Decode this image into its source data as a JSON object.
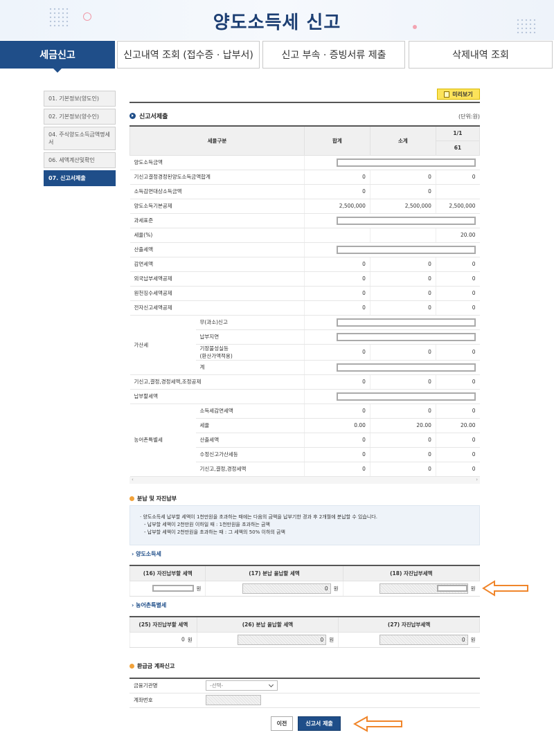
{
  "header": {
    "title": "양도소득세 신고"
  },
  "tabs": [
    {
      "label": "세금신고"
    },
    {
      "label": "신고내역 조회 (접수증 · 납부서)"
    },
    {
      "label": "신고 부속 · 증빙서류 제출"
    },
    {
      "label": "삭제내역 조회"
    }
  ],
  "sidebar": {
    "items": [
      {
        "label": "01. 기본정보(양도인)"
      },
      {
        "label": "02. 기본정보(양수인)"
      },
      {
        "label": "04. 주식양도소득금액명세서"
      },
      {
        "label": "06. 세액계산및확인"
      },
      {
        "label": "07. 신고서제출"
      }
    ]
  },
  "toolbar": {
    "preview_label": "미리보기"
  },
  "section": {
    "title": "신고서제출",
    "unit": "(단위:원)"
  },
  "table": {
    "headers": {
      "category": "세율구분",
      "total": "합계",
      "subtotal": "소계",
      "page": "1/1",
      "code": "61"
    },
    "rows": [
      {
        "label": "양도소득금액",
        "total": "",
        "subtotal": "",
        "col61": ""
      },
      {
        "label": "기신고결정경정된양도소득금액합계",
        "total": "0",
        "subtotal": "0",
        "col61": "0"
      },
      {
        "label": "소득감면대상소득금액",
        "total": "0",
        "subtotal": "0",
        "col61": ""
      },
      {
        "label": "양도소득기본공제",
        "total": "2,500,000",
        "subtotal": "2,500,000",
        "col61": "2,500,000"
      },
      {
        "label": "과세표준",
        "total": "",
        "subtotal": "",
        "col61": ""
      },
      {
        "label": "세율(%)",
        "total": "",
        "subtotal": "",
        "col61": "20.00"
      },
      {
        "label": "산출세액",
        "total": "",
        "subtotal": "",
        "col61": ""
      },
      {
        "label": "감면세액",
        "total": "0",
        "subtotal": "0",
        "col61": "0"
      },
      {
        "label": "외국납부세액공제",
        "total": "0",
        "subtotal": "0",
        "col61": "0"
      },
      {
        "label": "원천징수세액공제",
        "total": "0",
        "subtotal": "0",
        "col61": "0"
      },
      {
        "label": "전자신고세액공제",
        "total": "0",
        "subtotal": "0",
        "col61": "0"
      }
    ],
    "penalty": {
      "label": "가산세",
      "rows": [
        {
          "label": "무(과소)신고",
          "total": "",
          "subtotal": "",
          "col61": ""
        },
        {
          "label": "납부지연",
          "total": "",
          "subtotal": "",
          "col61": ""
        },
        {
          "label": "기장불성실등\n(환산가액적용)",
          "total": "0",
          "subtotal": "0",
          "col61": "0"
        },
        {
          "label": "계",
          "total": "",
          "subtotal": "",
          "col61": ""
        }
      ]
    },
    "rows2": [
      {
        "label": "기신고,결정,경정세액,조정공제",
        "total": "0",
        "subtotal": "0",
        "col61": "0"
      },
      {
        "label": "납부할세액",
        "total": "",
        "subtotal": "",
        "col61": ""
      }
    ],
    "rural": {
      "label": "농어촌특별세",
      "rows": [
        {
          "label": "소득세감면세액",
          "total": "0",
          "subtotal": "0",
          "col61": "0"
        },
        {
          "label": "세율",
          "total": "0.00",
          "subtotal": "20.00",
          "col61": "20.00"
        },
        {
          "label": "산출세액",
          "total": "0",
          "subtotal": "0",
          "col61": "0"
        },
        {
          "label": "수정신고가산세등",
          "total": "0",
          "subtotal": "0",
          "col61": "0"
        },
        {
          "label": "기신고,결정,경정세액",
          "total": "0",
          "subtotal": "0",
          "col61": "0"
        }
      ]
    },
    "scroll_left": "‹",
    "scroll_right": "›"
  },
  "installment": {
    "title": "분납 및 자진납부",
    "notes": [
      "· 양도소득세 납부할 세액이 1천만원을 초과하는 때에는 다음의 금액을 납부기한 경과 후 2개월에 분납할 수 있습니다.",
      "- 납부할 세액이 2천만원 이하일 때 : 1천만원을 초과하는 금액",
      "- 납부할 세액이 2천만원을 초과하는 때 : 그 세액의 50% 이하의 금액"
    ],
    "transfer_tax": {
      "title": "› 양도소득세",
      "headers": [
        "(16) 자진납부할 세액",
        "(17) 분납 올납할 세액",
        "(18) 자진납부세액"
      ],
      "values": [
        "",
        "0",
        ""
      ],
      "unit": "원"
    },
    "rural_tax": {
      "title": "› 농어촌특별세",
      "headers": [
        "(25) 자진납부할 세액",
        "(26) 분납 올납할 세액",
        "(27) 자진납부세액"
      ],
      "values": [
        "0",
        "0",
        "0"
      ],
      "unit": "원"
    }
  },
  "refund": {
    "title": "환급금 계좌신고",
    "bank_label": "금융기관명",
    "bank_placeholder": "-선택-",
    "account_label": "계좌번호",
    "account_value": ""
  },
  "actions": {
    "prev_label": "이전",
    "submit_label": "신고서 제출"
  },
  "colors": {
    "primary": "#1f4e89",
    "accent_arrow": "#f0852a",
    "preview": "#fce35a"
  }
}
